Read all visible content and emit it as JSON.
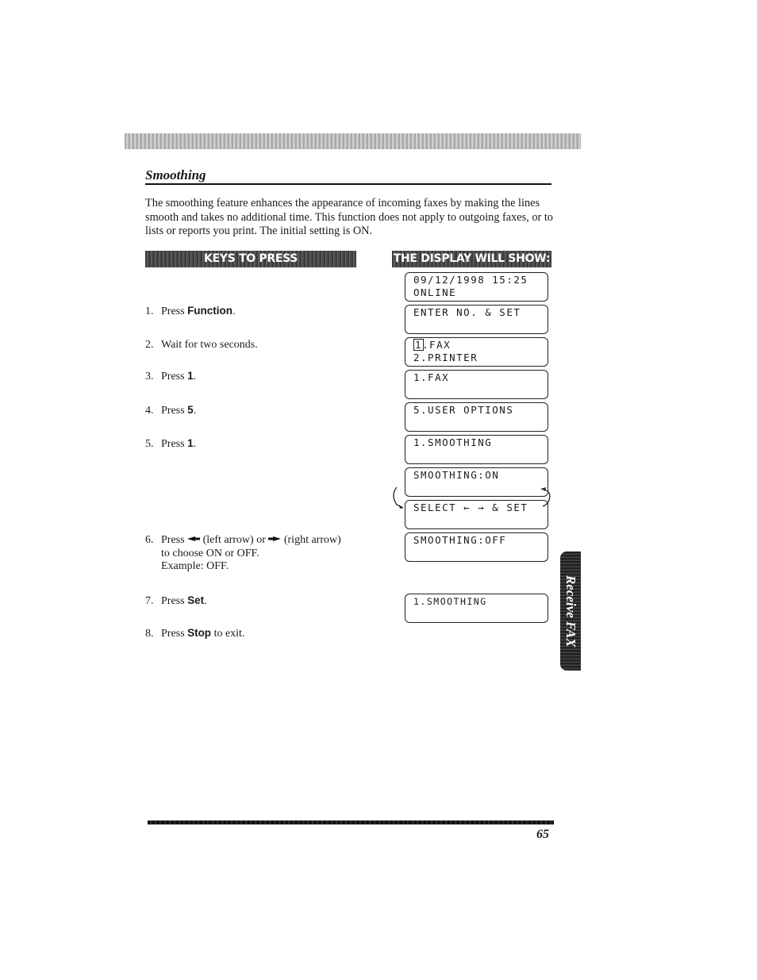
{
  "section": {
    "title": "Smoothing",
    "intro": "The smoothing feature enhances the appearance of incoming faxes by making the lines smooth and takes no additional time. This function does not apply to outgoing faxes, or to lists or reports you print. The initial setting is ON."
  },
  "headers": {
    "keys": "KEYS TO PRESS",
    "display": "THE DISPLAY WILL SHOW:"
  },
  "steps": [
    {
      "num": "1.",
      "pre": "Press ",
      "key": "Function",
      "post": "."
    },
    {
      "num": "2.",
      "pre": "Wait for two seconds.",
      "key": "",
      "post": ""
    },
    {
      "num": "3.",
      "pre": "Press ",
      "key": "1",
      "post": "."
    },
    {
      "num": "4.",
      "pre": "Press ",
      "key": "5",
      "post": "."
    },
    {
      "num": "5.",
      "pre": "Press ",
      "key": "1",
      "post": "."
    },
    {
      "num": "6.",
      "pre": "Press ",
      "left": "(left arrow) or ",
      "right": "(right arrow)",
      "line2": "to choose ON or OFF.",
      "line3": "Example: OFF."
    },
    {
      "num": "7.",
      "pre": "Press ",
      "key": "Set",
      "post": "."
    },
    {
      "num": "8.",
      "pre": "Press ",
      "key": "Stop",
      "post": " to exit."
    }
  ],
  "displays": [
    {
      "line1": "09/12/1998 15:25",
      "line2": "ONLINE"
    },
    {
      "line1": "ENTER NO. & SET",
      "line2": ""
    },
    {
      "cursor": "1",
      "line1": ".FAX",
      "line2": "2.PRINTER"
    },
    {
      "line1": "1.FAX",
      "line2": ""
    },
    {
      "line1": "5.USER OPTIONS",
      "line2": ""
    },
    {
      "line1": "1.SMOOTHING",
      "line2": ""
    },
    {
      "line1": "SMOOTHING:ON",
      "line2": ""
    },
    {
      "line1": "SELECT ← → & SET",
      "line2": ""
    },
    {
      "line1": "SMOOTHING:OFF",
      "line2": ""
    },
    {
      "line1": "1.SMOOTHING",
      "line2": ""
    }
  ],
  "side_tab": "Receive FAX",
  "page_number": "65"
}
